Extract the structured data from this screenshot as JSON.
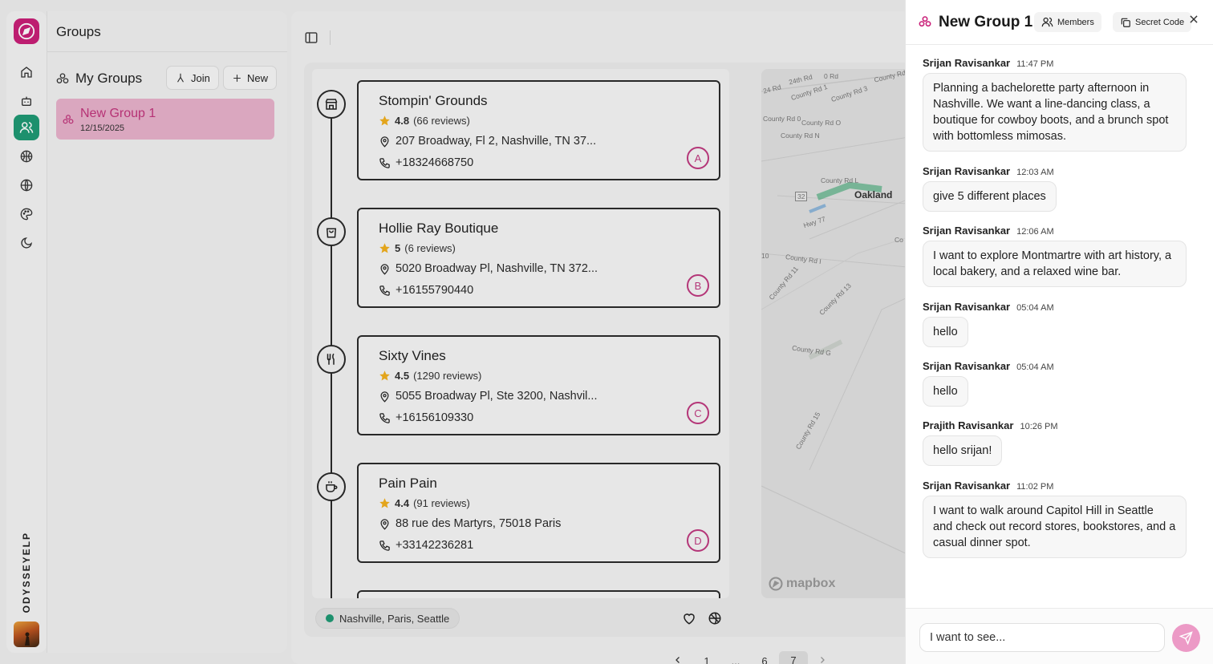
{
  "rail": {
    "brand": "ODYSSEYELP",
    "items": [
      {
        "icon": "home-icon"
      },
      {
        "icon": "bot-icon"
      },
      {
        "icon": "users-icon",
        "active": true
      },
      {
        "icon": "basketball-icon"
      },
      {
        "icon": "globe-icon"
      },
      {
        "icon": "palette-icon"
      },
      {
        "icon": "moon-icon"
      }
    ]
  },
  "groups_panel": {
    "title": "Groups",
    "section_title": "My Groups",
    "join_label": "Join",
    "new_label": "New",
    "groups": [
      {
        "name": "New Group 1",
        "date": "12/15/2025"
      }
    ]
  },
  "results": {
    "places": [
      {
        "name": "Stompin' Grounds",
        "rating": "4.8",
        "reviews": "(66 reviews)",
        "address": "207 Broadway, Fl 2, Nashville, TN 37...",
        "phone": "+18324668750",
        "letter": "A",
        "icon": "store-icon"
      },
      {
        "name": "Hollie Ray Boutique",
        "rating": "5",
        "reviews": "(6 reviews)",
        "address": "5020 Broadway Pl, Nashville, TN 372...",
        "phone": "+16155790440",
        "letter": "B",
        "icon": "shopping-bag-icon"
      },
      {
        "name": "Sixty Vines",
        "rating": "4.5",
        "reviews": "(1290 reviews)",
        "address": "5055 Broadway Pl, Ste 3200, Nashvil...",
        "phone": "+16156109330",
        "letter": "C",
        "icon": "utensils-icon"
      },
      {
        "name": "Pain Pain",
        "rating": "4.4",
        "reviews": "(91 reviews)",
        "address": "88 rue des Martyrs, 75018 Paris",
        "phone": "+33142236281",
        "letter": "D",
        "icon": "coffee-icon"
      }
    ],
    "locations": "Nashville, Paris, Seattle",
    "map": {
      "attribution": "mapbox",
      "city": "Oakland",
      "labels": [
        "24th Rd",
        "0 Rd",
        "County Rd",
        "24 Rd",
        "County Rd 1",
        "County Rd 3",
        "County Rd 0",
        "County Rd O",
        "County Rd N",
        "County Rd L",
        "32",
        "Hwy 77",
        "Co",
        "10",
        "County Rd I",
        "County Rd 11",
        "County Rd 13",
        "County Rd G",
        "County Rd 15"
      ]
    },
    "pager": {
      "pages": [
        "1",
        "...",
        "6",
        "7"
      ],
      "current": "7"
    }
  },
  "chat": {
    "title": "New Group 1",
    "members_label": "Members",
    "secret_code_label": "Secret Code",
    "messages": [
      {
        "author": "Srijan Ravisankar",
        "time": "11:47 PM",
        "text": "Planning a bachelorette party afternoon in Nashville. We want a line-dancing class, a boutique for cowboy boots, and a brunch spot with bottomless mimosas."
      },
      {
        "author": "Srijan Ravisankar",
        "time": "12:03 AM",
        "text": "give 5 different places"
      },
      {
        "author": "Srijan Ravisankar",
        "time": "12:06 AM",
        "text": "I want to explore Montmartre with art history, a local bakery, and a relaxed wine bar."
      },
      {
        "author": "Srijan Ravisankar",
        "time": "05:04 AM",
        "text": "hello"
      },
      {
        "author": "Srijan Ravisankar",
        "time": "05:04 AM",
        "text": "hello"
      },
      {
        "author": "Prajith Ravisankar",
        "time": "10:26 PM",
        "text": "hello srijan!"
      },
      {
        "author": "Srijan Ravisankar",
        "time": "11:02 PM",
        "text": "I want to walk around Capitol Hill in Seattle and check out record stores, bookstores, and a casual dinner spot."
      }
    ],
    "input_placeholder": "I want to see..."
  },
  "colors": {
    "brand": "#c91f78",
    "active_nav": "#1f9a74",
    "accent_pink": "#c03a80",
    "send_button": "#ec9ac6",
    "star": "#f2b01e"
  }
}
